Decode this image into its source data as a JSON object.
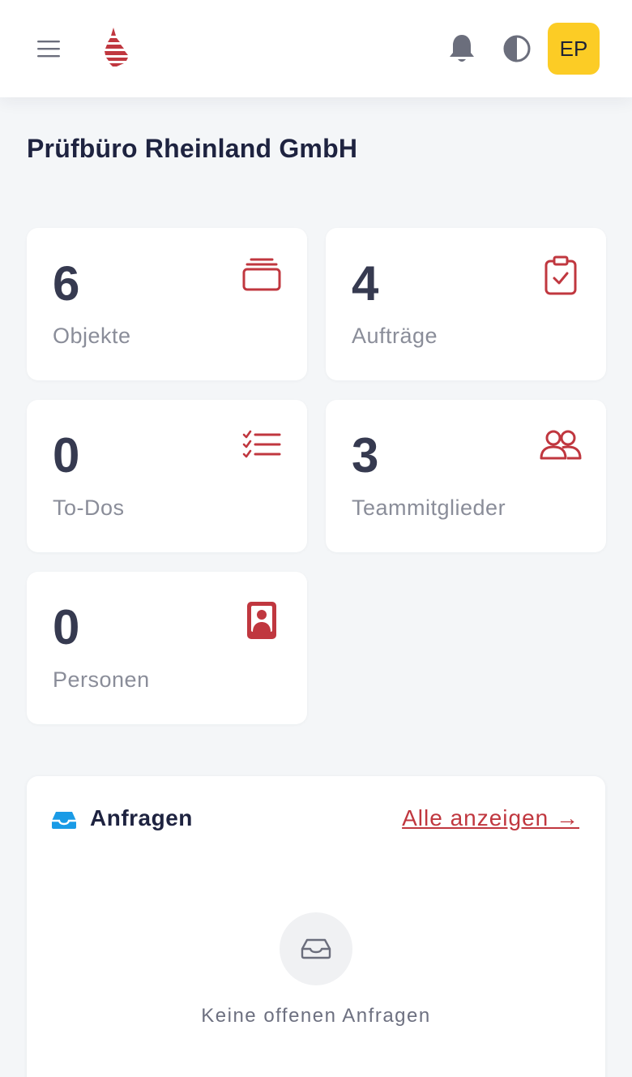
{
  "header": {
    "avatar_initials": "EP",
    "avatar_color": "#fccc25",
    "icons": [
      "menu-icon",
      "logo",
      "bell-icon",
      "theme-toggle-icon"
    ]
  },
  "page": {
    "title": "Prüfbüro Rheinland GmbH"
  },
  "stats": [
    {
      "value": "6",
      "label": "Objekte",
      "icon": "cards-stack-icon"
    },
    {
      "value": "4",
      "label": "Aufträge",
      "icon": "clipboard-check-icon"
    },
    {
      "value": "0",
      "label": "To-Dos",
      "icon": "checklist-icon"
    },
    {
      "value": "3",
      "label": "Teammitglieder",
      "icon": "users-icon"
    },
    {
      "value": "0",
      "label": "Personen",
      "icon": "contact-card-icon"
    }
  ],
  "requests": {
    "title": "Anfragen",
    "link_label": "Alle anzeigen →",
    "empty_text": "Keine offenen Anfragen",
    "icon": "inbox-icon"
  },
  "colors": {
    "accent": "#c0373f",
    "info_blue": "#1a9be6",
    "background": "#f4f6f8"
  }
}
